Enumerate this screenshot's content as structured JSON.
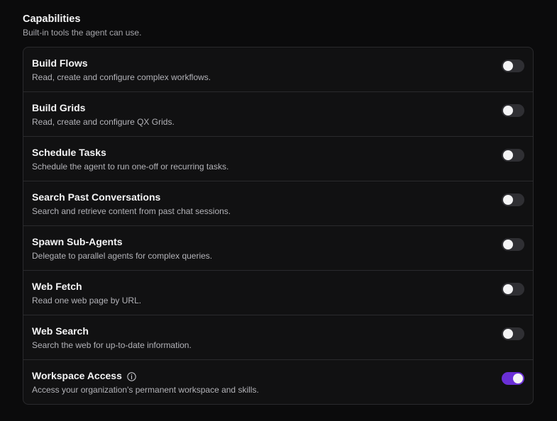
{
  "section": {
    "title": "Capabilities",
    "subtitle": "Built-in tools the agent can use."
  },
  "colors": {
    "toggle_on": "#6a2fd6",
    "toggle_off": "#2f2f33"
  },
  "capabilities": [
    {
      "title": "Build Flows",
      "description": "Read, create and configure complex workflows.",
      "enabled": false,
      "info_icon": false
    },
    {
      "title": "Build Grids",
      "description": "Read, create and configure QX Grids.",
      "enabled": false,
      "info_icon": false
    },
    {
      "title": "Schedule Tasks",
      "description": "Schedule the agent to run one-off or recurring tasks.",
      "enabled": false,
      "info_icon": false
    },
    {
      "title": "Search Past Conversations",
      "description": "Search and retrieve content from past chat sessions.",
      "enabled": false,
      "info_icon": false
    },
    {
      "title": "Spawn Sub-Agents",
      "description": "Delegate to parallel agents for complex queries.",
      "enabled": false,
      "info_icon": false
    },
    {
      "title": "Web Fetch",
      "description": "Read one web page by URL.",
      "enabled": false,
      "info_icon": false
    },
    {
      "title": "Web Search",
      "description": "Search the web for up-to-date information.",
      "enabled": false,
      "info_icon": false
    },
    {
      "title": "Workspace Access",
      "description": "Access your organization's permanent workspace and skills.",
      "enabled": true,
      "info_icon": true,
      "info_icon_name": "info-icon"
    }
  ]
}
